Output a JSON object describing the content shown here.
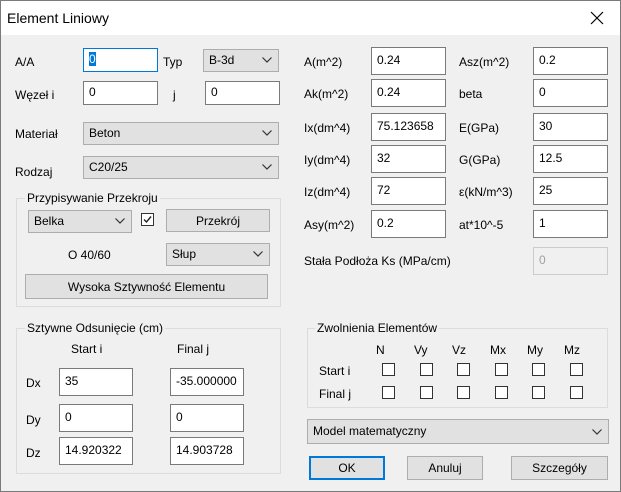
{
  "window": {
    "title": "Element Liniowy"
  },
  "left": {
    "aa_label": "A/A",
    "aa_value": "0",
    "typ_label": "Typ",
    "typ_value": "B-3d",
    "wezel_label": "Węzeł i",
    "wezel_value": "0",
    "j_label": "j",
    "j_value": "0",
    "material_label": "Materiał",
    "material_value": "Beton",
    "rodzaj_label": "Rodzaj",
    "rodzaj_value": "C20/25"
  },
  "przekroj": {
    "title": "Przypisywanie Przekroju",
    "type_value": "Belka",
    "checkbox_checked": true,
    "button_label": "Przekrój",
    "section_name": "O 40/60",
    "element_value": "Słup",
    "stiff_button_label": "Wysoka Sztywność Elementu"
  },
  "offset": {
    "title": "Sztywne Odsunięcie (cm)",
    "start_label": "Start i",
    "final_label": "Final j",
    "rows": [
      {
        "label": "Dx",
        "start": "35",
        "final": "-35.000000"
      },
      {
        "label": "Dy",
        "start": "0",
        "final": "0"
      },
      {
        "label": "Dz",
        "start": "14.920322",
        "final": "14.903728"
      }
    ]
  },
  "props": {
    "col1": [
      {
        "label": "A(m^2)",
        "value": "0.24"
      },
      {
        "label": "Ak(m^2)",
        "value": "0.24"
      },
      {
        "label": "Ix(dm^4)",
        "value": "75.123658"
      },
      {
        "label": "Iy(dm^4)",
        "value": "32"
      },
      {
        "label": "Iz(dm^4)",
        "value": "72"
      },
      {
        "label": "Asy(m^2)",
        "value": "0.2"
      }
    ],
    "col2": [
      {
        "label": "Asz(m^2)",
        "value": "0.2"
      },
      {
        "label": "beta",
        "value": "0"
      },
      {
        "label": "E(GPa)",
        "value": "30"
      },
      {
        "label": "G(GPa)",
        "value": "12.5"
      },
      {
        "label": "ε(kN/m^3)",
        "value": "25"
      },
      {
        "label": "at*10^-5",
        "value": "1"
      }
    ],
    "ks_label": "Stała Podłoża Ks (MPa/cm)",
    "ks_value": "0"
  },
  "releases": {
    "title": "Zwolnienia Elementów",
    "columns": [
      "N",
      "Vy",
      "Vz",
      "Mx",
      "My",
      "Mz"
    ],
    "rows": [
      "Start i",
      "Final j"
    ]
  },
  "model": {
    "value": "Model matematyczny"
  },
  "buttons": {
    "ok": "OK",
    "cancel": "Anuluj",
    "details": "Szczegóły"
  }
}
